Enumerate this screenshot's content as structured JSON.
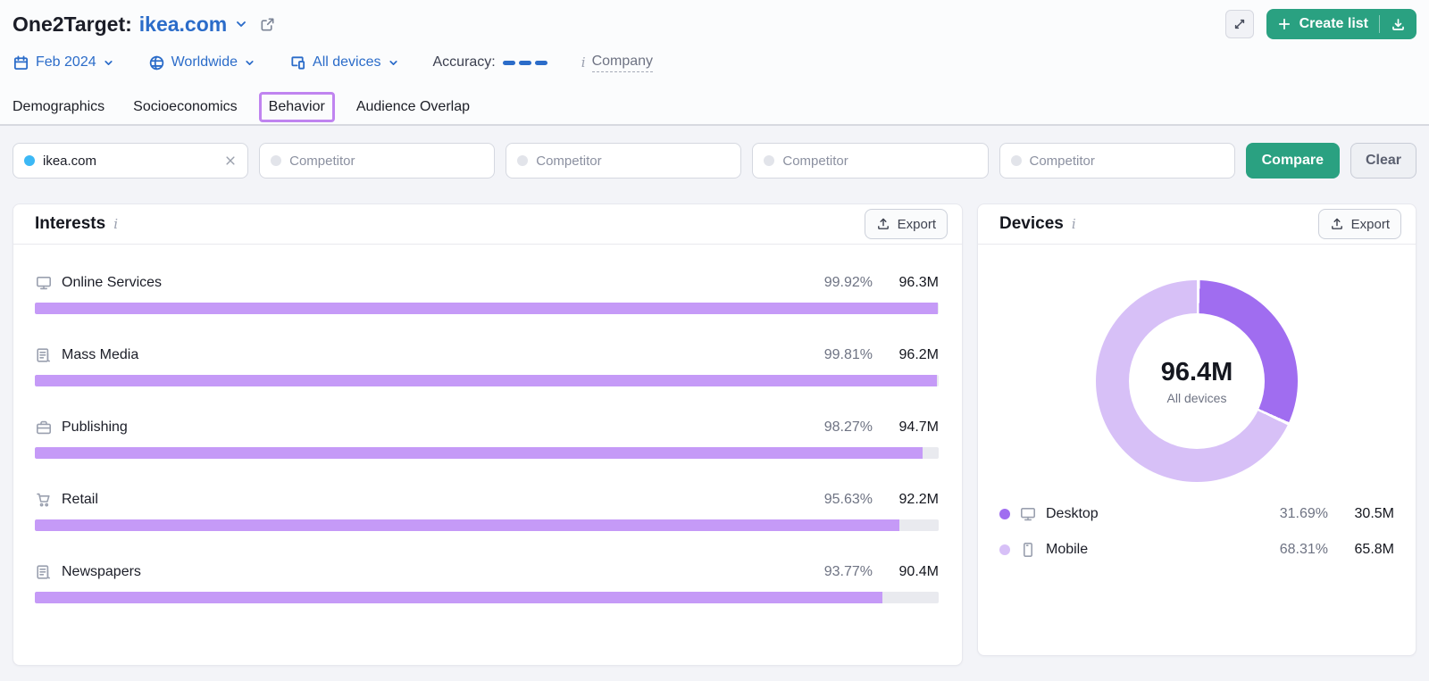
{
  "header": {
    "title_prefix": "One2Target:",
    "title_domain": "ikea.com",
    "create_list_label": "Create list",
    "filters": {
      "date": "Feb 2024",
      "location": "Worldwide",
      "devices": "All devices",
      "accuracy_label": "Accuracy:",
      "company_label": "Company"
    },
    "tabs": [
      {
        "label": "Demographics"
      },
      {
        "label": "Socioeconomics"
      },
      {
        "label": "Behavior"
      },
      {
        "label": "Audience Overlap"
      }
    ],
    "active_tab": "Behavior"
  },
  "competitor_bar": {
    "selected_domain": "ikea.com",
    "competitor_placeholder": "Competitor",
    "compare_label": "Compare",
    "clear_label": "Clear"
  },
  "interests": {
    "title": "Interests",
    "export_label": "Export",
    "rows": [
      {
        "icon": "monitor-icon",
        "label": "Online Services",
        "percent": "99.92%",
        "reach": "96.3M",
        "value": 99.92
      },
      {
        "icon": "newspaper-icon",
        "label": "Mass Media",
        "percent": "99.81%",
        "reach": "96.2M",
        "value": 99.81
      },
      {
        "icon": "briefcase-icon",
        "label": "Publishing",
        "percent": "98.27%",
        "reach": "94.7M",
        "value": 98.27
      },
      {
        "icon": "cart-icon",
        "label": "Retail",
        "percent": "95.63%",
        "reach": "92.2M",
        "value": 95.63
      },
      {
        "icon": "newspaper-icon",
        "label": "Newspapers",
        "percent": "93.77%",
        "reach": "90.4M",
        "value": 93.77
      }
    ]
  },
  "devices": {
    "title": "Devices",
    "export_label": "Export",
    "center_value": "96.4M",
    "center_label": "All devices",
    "legend": [
      {
        "icon": "monitor-icon",
        "label": "Desktop",
        "percent": "31.69%",
        "reach": "30.5M",
        "value": 31.69,
        "color": "#a06df0"
      },
      {
        "icon": "phone-icon",
        "label": "Mobile",
        "percent": "68.31%",
        "reach": "65.8M",
        "value": 68.31,
        "color": "#d7c0f7"
      }
    ]
  },
  "colors": {
    "accent_blue": "#2b6cc9",
    "action_green": "#2aa181",
    "bar_fill_purple": "#c59af7",
    "bar_track_gray": "#e9eaef",
    "donut_desktop_purple": "#a06df0",
    "donut_mobile_purple": "#d7c0f7",
    "annotation_purple": "#c084f0",
    "selected_dot_blue": "#3cb8f5"
  },
  "chart_data": [
    {
      "type": "bar",
      "orientation": "horizontal",
      "title": "Interests",
      "categories": [
        "Online Services",
        "Mass Media",
        "Publishing",
        "Retail",
        "Newspapers"
      ],
      "values": [
        99.92,
        99.81,
        98.27,
        95.63,
        93.77
      ],
      "value_labels": [
        "99.92%",
        "99.81%",
        "98.27%",
        "95.63%",
        "93.77%"
      ],
      "reach_labels": [
        "96.3M",
        "96.2M",
        "94.7M",
        "92.2M",
        "90.4M"
      ],
      "xlim": [
        0,
        100
      ],
      "unit": "%"
    },
    {
      "type": "pie",
      "donut": true,
      "title": "Devices",
      "categories": [
        "Desktop",
        "Mobile"
      ],
      "values": [
        31.69,
        68.31
      ],
      "value_labels": [
        "31.69%",
        "68.31%"
      ],
      "reach_labels": [
        "30.5M",
        "65.8M"
      ],
      "center_value": "96.4M",
      "center_label": "All devices",
      "legend_position": "bottom"
    }
  ]
}
